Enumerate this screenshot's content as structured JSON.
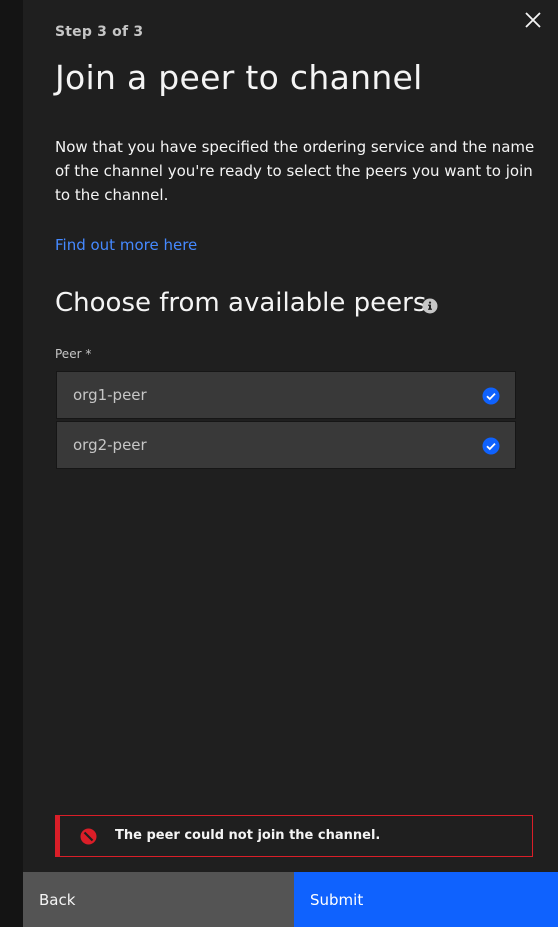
{
  "modal": {
    "step_label": "Step 3 of 3",
    "title": "Join a peer to channel",
    "description": "Now that you have specified the ordering service and the name of the channel you're ready to select the peers you want to join to the channel.",
    "link_text": "Find out more here",
    "close_icon": "close-icon"
  },
  "peers_section": {
    "title": "Choose from available peers",
    "info_icon": "info-icon",
    "field_label": "Peer *",
    "peers": [
      {
        "name": "org1-peer",
        "selected": true
      },
      {
        "name": "org2-peer",
        "selected": true
      }
    ]
  },
  "error": {
    "message": "The peer could not join the channel.",
    "icon": "error-icon",
    "color": "#da1e28"
  },
  "footer": {
    "back_label": "Back",
    "submit_label": "Submit"
  },
  "colors": {
    "primary": "#0f62fe",
    "link": "#4589ff",
    "panel_bg": "#1f1f1f",
    "check": "#0f62fe"
  }
}
